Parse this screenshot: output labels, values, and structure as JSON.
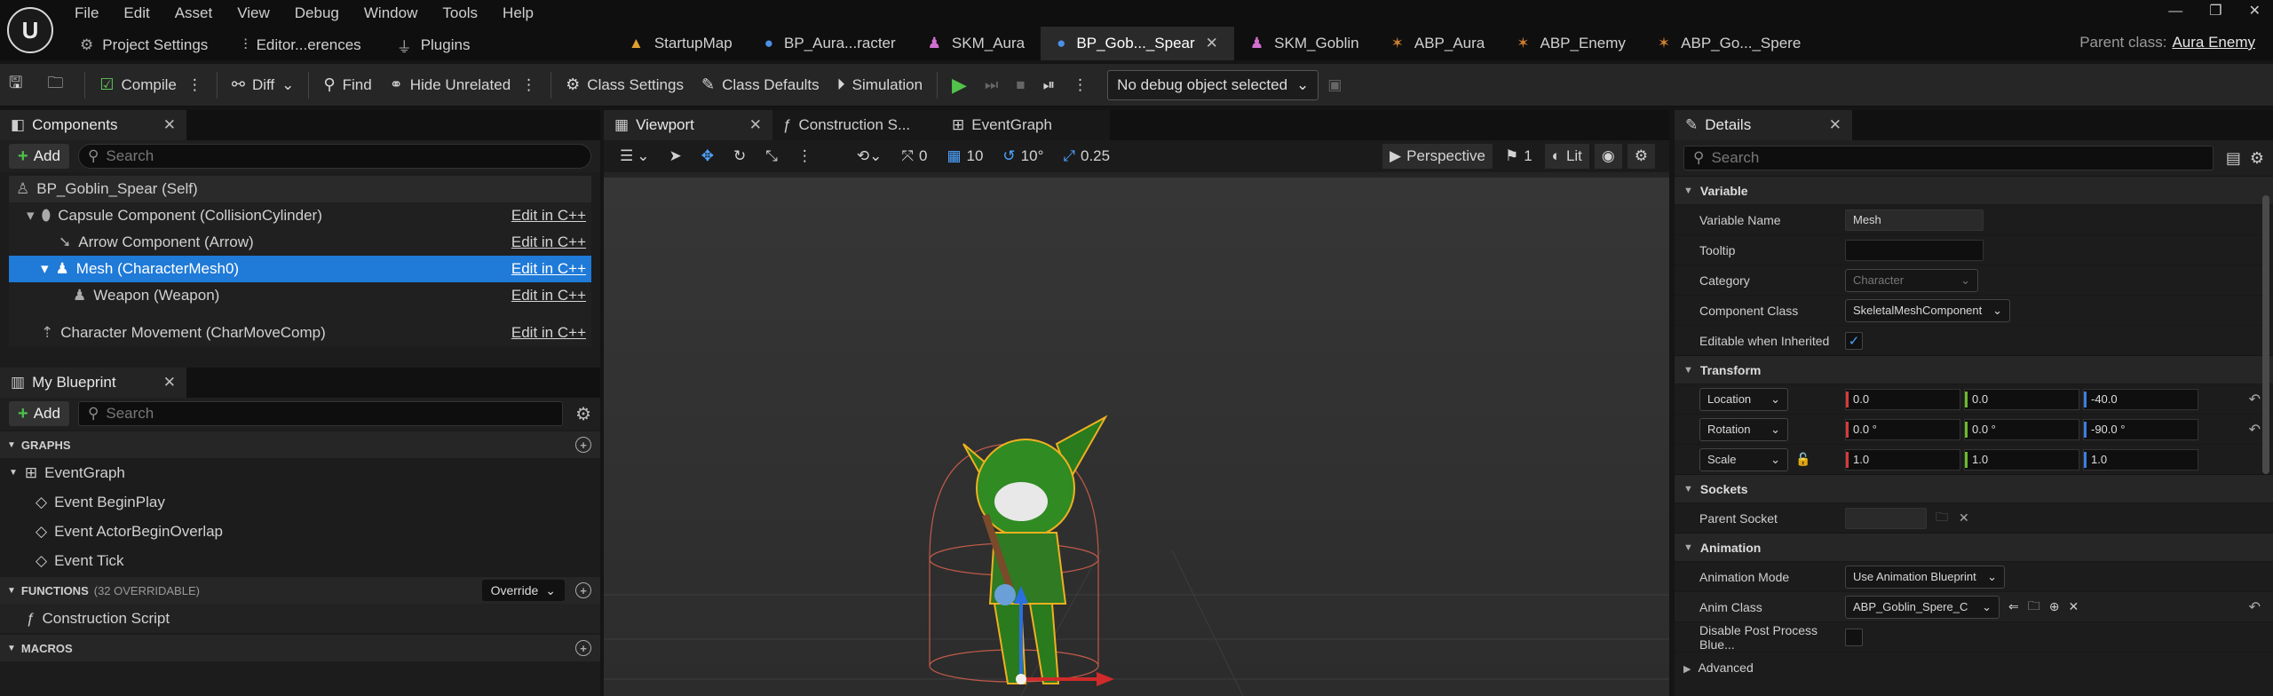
{
  "menu": [
    "File",
    "Edit",
    "Asset",
    "View",
    "Debug",
    "Window",
    "Tools",
    "Help"
  ],
  "subtabs": [
    {
      "label": "Project Settings",
      "icon": "gear-icon"
    },
    {
      "label": "Editor...erences",
      "icon": "sliders-icon"
    },
    {
      "label": "Plugins",
      "icon": "plug-icon"
    }
  ],
  "doc_tabs": [
    {
      "label": "StartupMap",
      "icon": "map-icon",
      "active": false
    },
    {
      "label": "BP_Aura...racter",
      "icon": "blueprint-icon",
      "active": false
    },
    {
      "label": "SKM_Aura",
      "icon": "skeletal-mesh-icon",
      "active": false
    },
    {
      "label": "BP_Gob..._Spear",
      "icon": "blueprint-icon",
      "active": true
    },
    {
      "label": "SKM_Goblin",
      "icon": "skeletal-mesh-icon",
      "active": false
    },
    {
      "label": "ABP_Aura",
      "icon": "anim-blueprint-icon",
      "active": false
    },
    {
      "label": "ABP_Enemy",
      "icon": "anim-blueprint-icon",
      "active": false
    },
    {
      "label": "ABP_Go..._Spere",
      "icon": "anim-blueprint-icon",
      "active": false
    }
  ],
  "parent_class": {
    "label": "Parent class:",
    "value": "Aura Enemy"
  },
  "toolbar": {
    "compile": "Compile",
    "diff": "Diff",
    "find": "Find",
    "hide_unrelated": "Hide Unrelated",
    "class_settings": "Class Settings",
    "class_defaults": "Class Defaults",
    "simulation": "Simulation",
    "debug_object": "No debug object selected"
  },
  "components": {
    "tab": "Components",
    "add": "Add",
    "search_placeholder": "Search",
    "items": [
      {
        "label": "BP_Goblin_Spear (Self)",
        "edit": ""
      },
      {
        "label": "Capsule Component (CollisionCylinder)",
        "edit": "Edit in C++"
      },
      {
        "label": "Arrow Component (Arrow)",
        "edit": "Edit in C++"
      },
      {
        "label": "Mesh (CharacterMesh0)",
        "edit": "Edit in C++"
      },
      {
        "label": "Weapon (Weapon)",
        "edit": "Edit in C++"
      },
      {
        "label": "Character Movement (CharMoveComp)",
        "edit": "Edit in C++"
      }
    ]
  },
  "my_blueprint": {
    "tab": "My Blueprint",
    "add": "Add",
    "search_placeholder": "Search",
    "graphs_header": "GRAPHS",
    "event_graph": "EventGraph",
    "events": [
      "Event BeginPlay",
      "Event ActorBeginOverlap",
      "Event Tick"
    ],
    "functions_header": "FUNCTIONS",
    "functions_count": "(32 OVERRIDABLE)",
    "override": "Override",
    "construction_script": "Construction Script",
    "macros_header": "MACROS"
  },
  "center_tabs": [
    "Viewport",
    "Construction S...",
    "EventGraph"
  ],
  "viewport_bar": {
    "rot_snap": "0",
    "grid": "10",
    "angle": "10°",
    "scale": "0.25",
    "perspective": "Perspective",
    "camera_speed": "1",
    "lit": "Lit"
  },
  "details": {
    "tab": "Details",
    "search_placeholder": "Search",
    "variable": {
      "header": "Variable",
      "name_label": "Variable Name",
      "name_value": "Mesh",
      "tooltip_label": "Tooltip",
      "tooltip_value": "",
      "category_label": "Category",
      "category_value": "Character",
      "component_class_label": "Component Class",
      "component_class_value": "SkeletalMeshComponent",
      "editable_label": "Editable when Inherited"
    },
    "transform": {
      "header": "Transform",
      "location": {
        "label": "Location",
        "x": "0.0",
        "y": "0.0",
        "z": "-40.0"
      },
      "rotation": {
        "label": "Rotation",
        "x": "0.0 °",
        "y": "0.0 °",
        "z": "-90.0 °"
      },
      "scale": {
        "label": "Scale",
        "x": "1.0",
        "y": "1.0",
        "z": "1.0"
      }
    },
    "sockets": {
      "header": "Sockets",
      "parent_socket_label": "Parent Socket"
    },
    "animation": {
      "header": "Animation",
      "mode_label": "Animation Mode",
      "mode_value": "Use Animation Blueprint",
      "anim_class_label": "Anim Class",
      "anim_class_value": "ABP_Goblin_Spere_C",
      "disable_pp_label": "Disable Post Process Blue..."
    },
    "advanced": "Advanced"
  }
}
